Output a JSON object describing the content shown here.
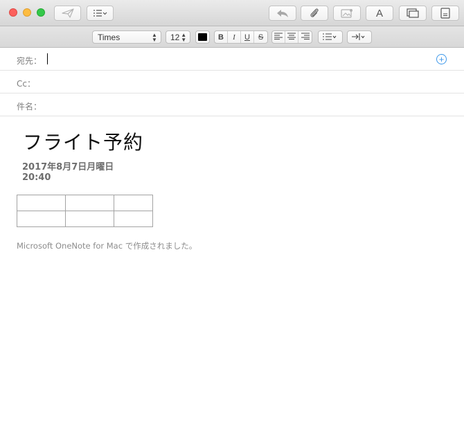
{
  "window": {
    "traffic_lights": [
      "close",
      "minimize",
      "zoom"
    ]
  },
  "toolbar": {
    "left": [
      {
        "icon": "send-icon"
      },
      {
        "icon": "header-fields-icon"
      }
    ],
    "right": [
      {
        "icon": "reply-icon"
      },
      {
        "icon": "paperclip-icon"
      },
      {
        "icon": "photo-browser-icon"
      },
      {
        "icon": "font-icon",
        "text": "A"
      },
      {
        "icon": "window-icon"
      },
      {
        "icon": "stationery-icon"
      }
    ]
  },
  "format": {
    "font_family": "Times",
    "font_size": "12",
    "text_color": "#000000",
    "style_buttons": [
      "B",
      "I",
      "U",
      "S"
    ],
    "align_icons": [
      "align-left-icon",
      "align-center-icon",
      "align-right-icon"
    ],
    "list_icon": "list-icon",
    "indent_icon": "indent-icon"
  },
  "header": {
    "to_label": "宛先：",
    "cc_label": "Cc：",
    "subject_label": "件名："
  },
  "body": {
    "title": "フライト予約",
    "date": "2017年8月7日月曜日",
    "time": "20:40",
    "table": [
      [
        "",
        "",
        ""
      ],
      [
        "",
        "",
        ""
      ]
    ],
    "footer": "Microsoft OneNote for Mac で作成されました。"
  },
  "colors": {
    "accent": "#3c97ea",
    "close": "#fc605c",
    "minimize": "#fdbc40",
    "zoom": "#34c84a"
  }
}
